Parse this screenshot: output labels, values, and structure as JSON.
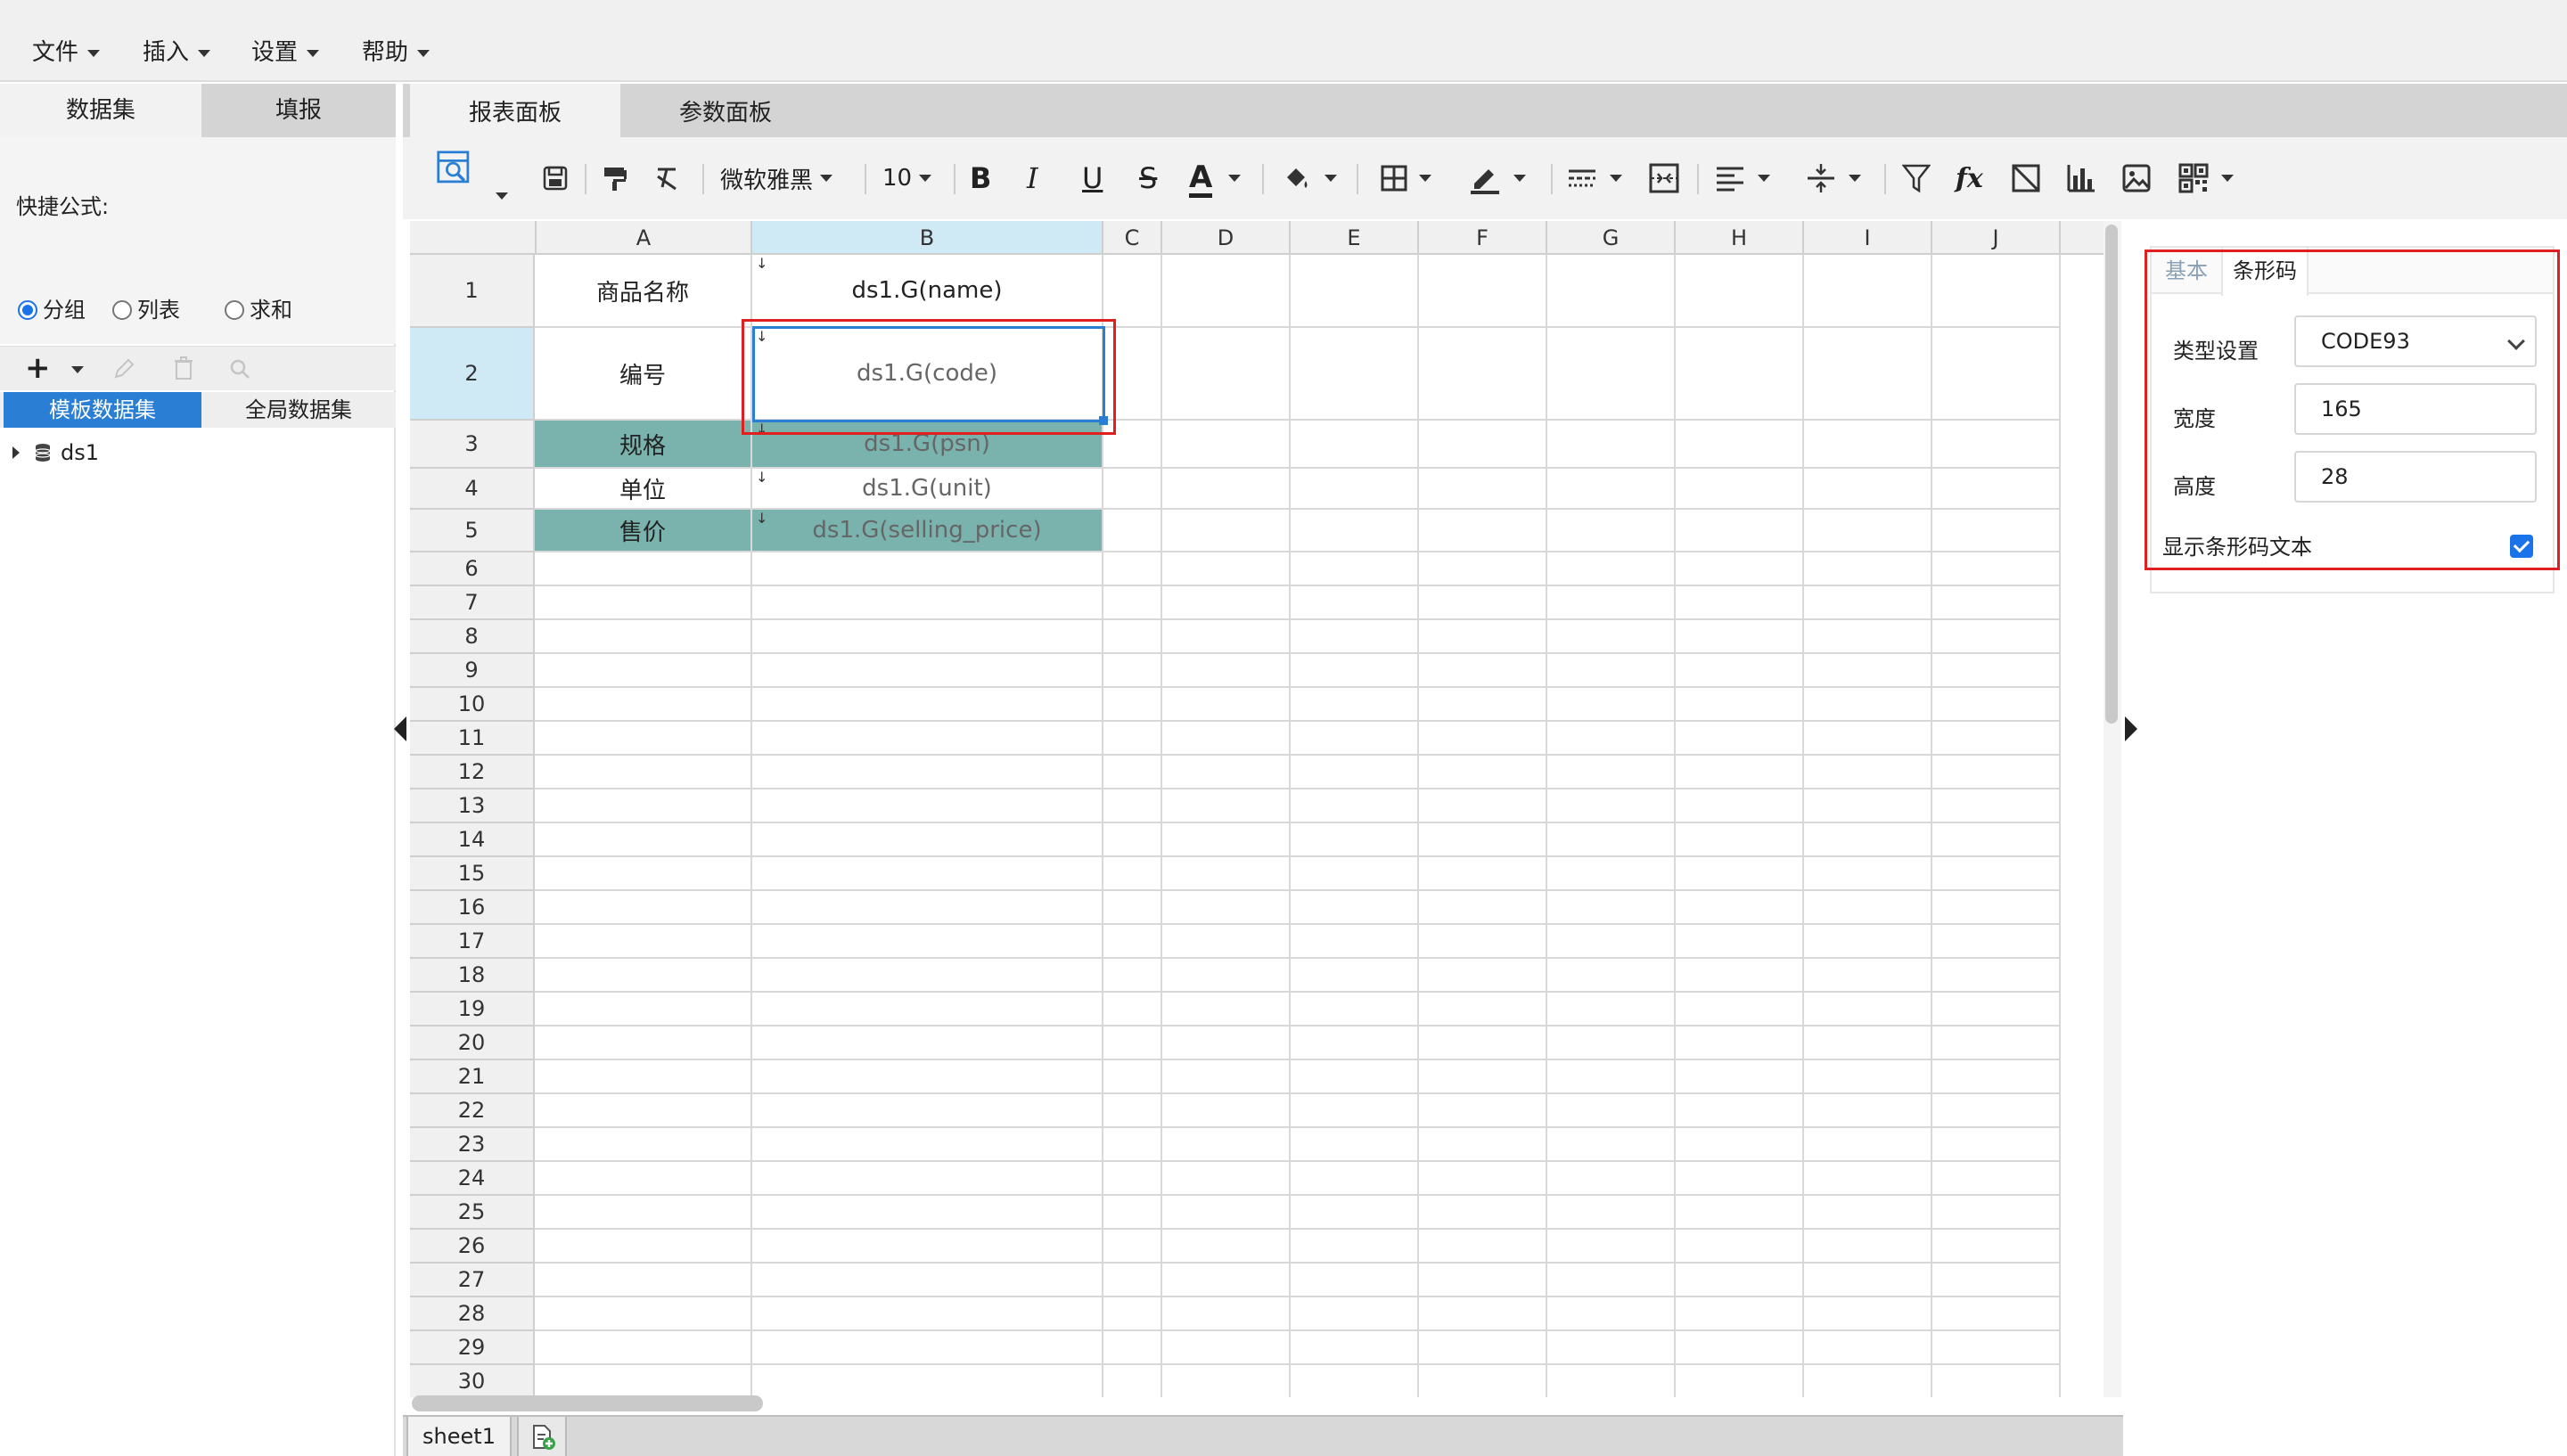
{
  "menubar": {
    "items": [
      {
        "label": "文件"
      },
      {
        "label": "插入"
      },
      {
        "label": "设置"
      },
      {
        "label": "帮助"
      }
    ]
  },
  "left_panel": {
    "tabs": [
      {
        "label": "数据集",
        "active": true
      },
      {
        "label": "填报",
        "active": false
      }
    ],
    "quick_formula_label": "快捷公式:",
    "radios": [
      {
        "label": "分组",
        "checked": true
      },
      {
        "label": "列表",
        "checked": false
      },
      {
        "label": "求和",
        "checked": false
      }
    ],
    "dataset_tabs": [
      {
        "label": "模板数据集",
        "active": true
      },
      {
        "label": "全局数据集",
        "active": false
      }
    ],
    "tree": [
      {
        "label": "ds1"
      }
    ],
    "icons": {
      "add": "plus-icon",
      "edit": "pencil-icon",
      "delete": "trash-icon",
      "search": "search-icon"
    }
  },
  "center_tabs": [
    {
      "label": "报表面板",
      "active": true
    },
    {
      "label": "参数面板",
      "active": false
    }
  ],
  "toolbar": {
    "font_family": "微软雅黑",
    "font_size": "10",
    "bold_label": "B",
    "italic_label": "I",
    "underline_label": "U",
    "strike_label": "S",
    "font_color_label": "A",
    "fx_label": "fx"
  },
  "grid": {
    "columns": [
      "A",
      "B",
      "C",
      "D",
      "E",
      "F",
      "G",
      "H",
      "I",
      "J"
    ],
    "selected_column": "B",
    "selected_row": 2,
    "rows": [
      {
        "num": "1",
        "a": "商品名称",
        "b": "ds1.G(name)"
      },
      {
        "num": "2",
        "a": "编号",
        "b": "ds1.G(code)"
      },
      {
        "num": "3",
        "a": "规格",
        "b": "ds1.G(psn)"
      },
      {
        "num": "4",
        "a": "单位",
        "b": "ds1.G(unit)"
      },
      {
        "num": "5",
        "a": "售价",
        "b": "ds1.G(selling_price)"
      }
    ],
    "empty_rows": [
      "6",
      "7",
      "8",
      "9",
      "10",
      "11",
      "12",
      "13",
      "14",
      "15",
      "16",
      "17",
      "18",
      "19",
      "20",
      "21",
      "22",
      "23",
      "24",
      "25",
      "26",
      "27",
      "28",
      "29",
      "30"
    ],
    "highlight_color": "#7ab3ad",
    "selection_color": "#2a7fd4"
  },
  "sheet_tabs": [
    {
      "label": "sheet1"
    }
  ],
  "property_panel": {
    "tabs": [
      {
        "label": "基本",
        "active": false
      },
      {
        "label": "条形码",
        "active": true
      }
    ],
    "type_label": "类型设置",
    "type_value": "CODE93",
    "width_label": "宽度",
    "width_value": "165",
    "height_label": "高度",
    "height_value": "28",
    "show_text_label": "显示条形码文本",
    "show_text_checked": true
  }
}
